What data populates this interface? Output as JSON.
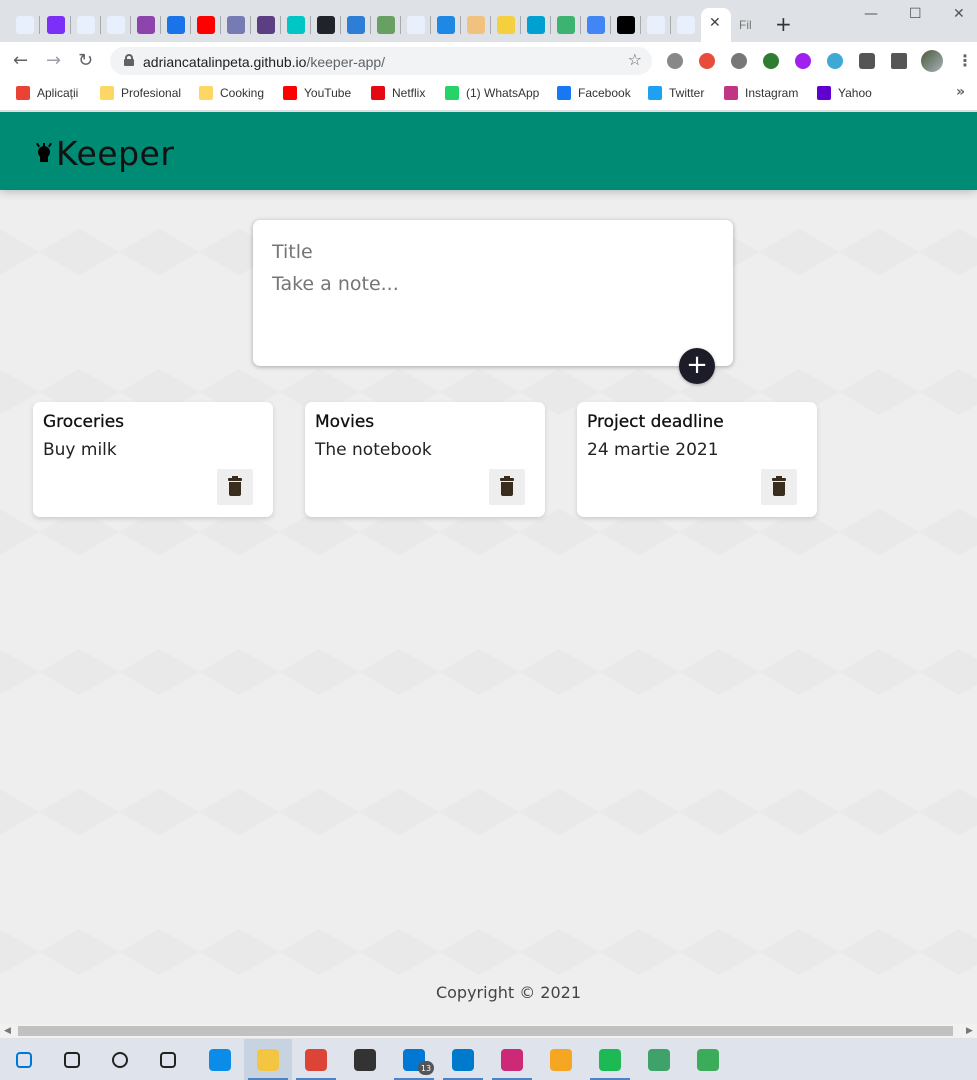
{
  "browser": {
    "tab_next_label": "Fil",
    "new_tab_glyph": "+",
    "close_tab_glyph": "✕",
    "url_host": "adriancatalinpeta.github.io",
    "url_path": "/keeper-app/",
    "window_controls": [
      "—",
      "☐",
      "✕"
    ],
    "tabs_favicon_colors": [
      "#e8f0fe",
      "#7b2ff7",
      "#e8f0fe",
      "#e8f0fe",
      "#8e44ad",
      "#1a73e8",
      "#ff0000",
      "#777bb3",
      "#5b3e84",
      "#00c6c6",
      "#20232a",
      "#2e7dd7",
      "#68a063",
      "#e8f0fe",
      "#1e88e5",
      "#f1c27d",
      "#f4d03f",
      "#00a0d1",
      "#3cb371",
      "#4285f4",
      "#000000",
      "#e8f0fe",
      "#e8f0fe"
    ]
  },
  "bookmarks": [
    {
      "label": "Aplicații",
      "icon": "apps-grid-icon",
      "color": "#ea4335"
    },
    {
      "label": "Profesional",
      "icon": "folder-icon",
      "color": "#fdd663"
    },
    {
      "label": "Cooking",
      "icon": "folder-icon",
      "color": "#fdd663"
    },
    {
      "label": "YouTube",
      "icon": "youtube-icon",
      "color": "#ff0000"
    },
    {
      "label": "Netflix",
      "icon": "netflix-icon",
      "color": "#e50914"
    },
    {
      "label": "(1) WhatsApp",
      "icon": "whatsapp-icon",
      "color": "#25d366"
    },
    {
      "label": "Facebook",
      "icon": "facebook-icon",
      "color": "#1877f2"
    },
    {
      "label": "Twitter",
      "icon": "twitter-icon",
      "color": "#1da1f2"
    },
    {
      "label": "Instagram",
      "icon": "instagram-icon",
      "color": "#c13584"
    },
    {
      "label": "Yahoo",
      "icon": "yahoo-icon",
      "color": "#6001d2"
    }
  ],
  "app": {
    "title": "Keeper",
    "header_color": "#008b75",
    "create": {
      "title_placeholder": "Title",
      "content_placeholder": "Take a note...",
      "add_glyph": "+"
    },
    "notes": [
      {
        "title": "Groceries",
        "content": "Buy milk"
      },
      {
        "title": "Movies",
        "content": "The notebook"
      },
      {
        "title": "Project deadline",
        "content": "24 martie 2021"
      }
    ],
    "footer": "Copyright © 2021"
  },
  "taskbar": {
    "mail_badge": "13",
    "items": [
      {
        "name": "windows-start-icon",
        "color": "#0078d7"
      },
      {
        "name": "search-icon",
        "color": "#222222"
      },
      {
        "name": "cortana-icon",
        "color": "#222222"
      },
      {
        "name": "task-view-icon",
        "color": "#222222"
      },
      {
        "name": "edge-icon",
        "color": "#0c8ce9"
      },
      {
        "name": "file-explorer-icon",
        "color": "#f4c542"
      },
      {
        "name": "chrome-icon",
        "color": "#db4437"
      },
      {
        "name": "store-icon",
        "color": "#333333"
      },
      {
        "name": "mail-icon",
        "color": "#0078d4"
      },
      {
        "name": "vscode-icon",
        "color": "#007acc"
      },
      {
        "name": "terminal-icon",
        "color": "#cc2a76"
      },
      {
        "name": "weather-icon",
        "color": "#f5a623"
      },
      {
        "name": "spotify-icon",
        "color": "#1db954"
      },
      {
        "name": "atom-icon",
        "color": "#40a26b"
      },
      {
        "name": "rocket-icon",
        "color": "#3cab5a"
      }
    ]
  }
}
